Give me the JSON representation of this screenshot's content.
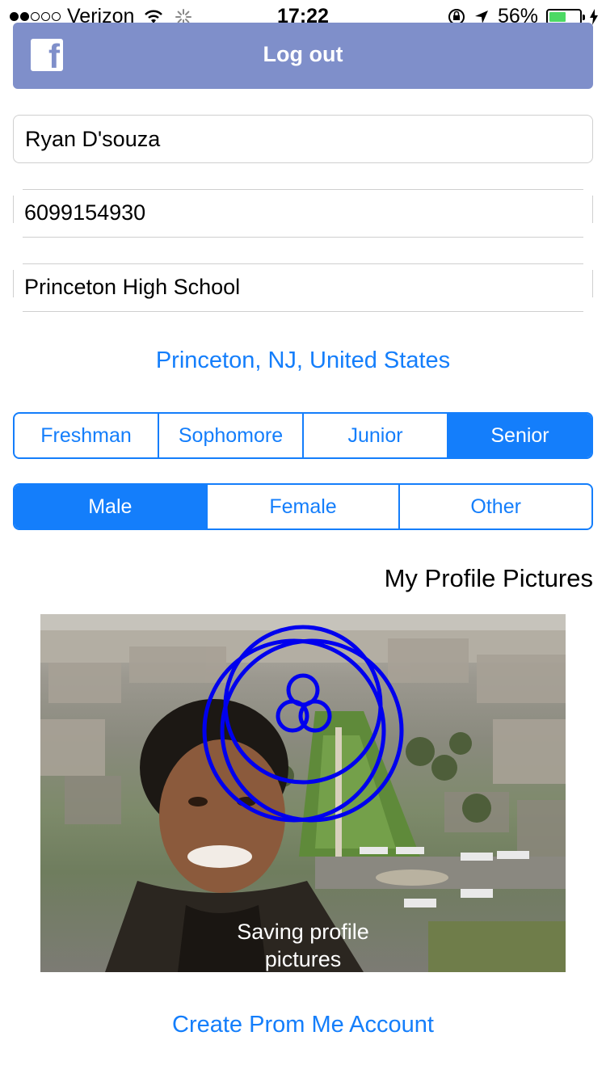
{
  "status_bar": {
    "carrier": "Verizon",
    "time": "17:22",
    "battery": "56%"
  },
  "header": {
    "logout_label": "Log out"
  },
  "form": {
    "name": "Ryan D'souza",
    "phone": "6099154930",
    "school": "Princeton High School",
    "location": "Princeton, NJ, United States"
  },
  "grade_options": [
    "Freshman",
    "Sophomore",
    "Junior",
    "Senior"
  ],
  "grade_selected": "Senior",
  "gender_options": [
    "Male",
    "Female",
    "Other"
  ],
  "gender_selected": "Male",
  "profile_pictures": {
    "title": "My Profile Pictures",
    "saving_text": "Saving profile pictures"
  },
  "footer": {
    "create_account_label": "Create Prom Me Account"
  },
  "colors": {
    "accent": "#147efb",
    "header_bg": "#7f8fca",
    "spinner": "#0000ee",
    "battery_green": "#4cd964"
  }
}
